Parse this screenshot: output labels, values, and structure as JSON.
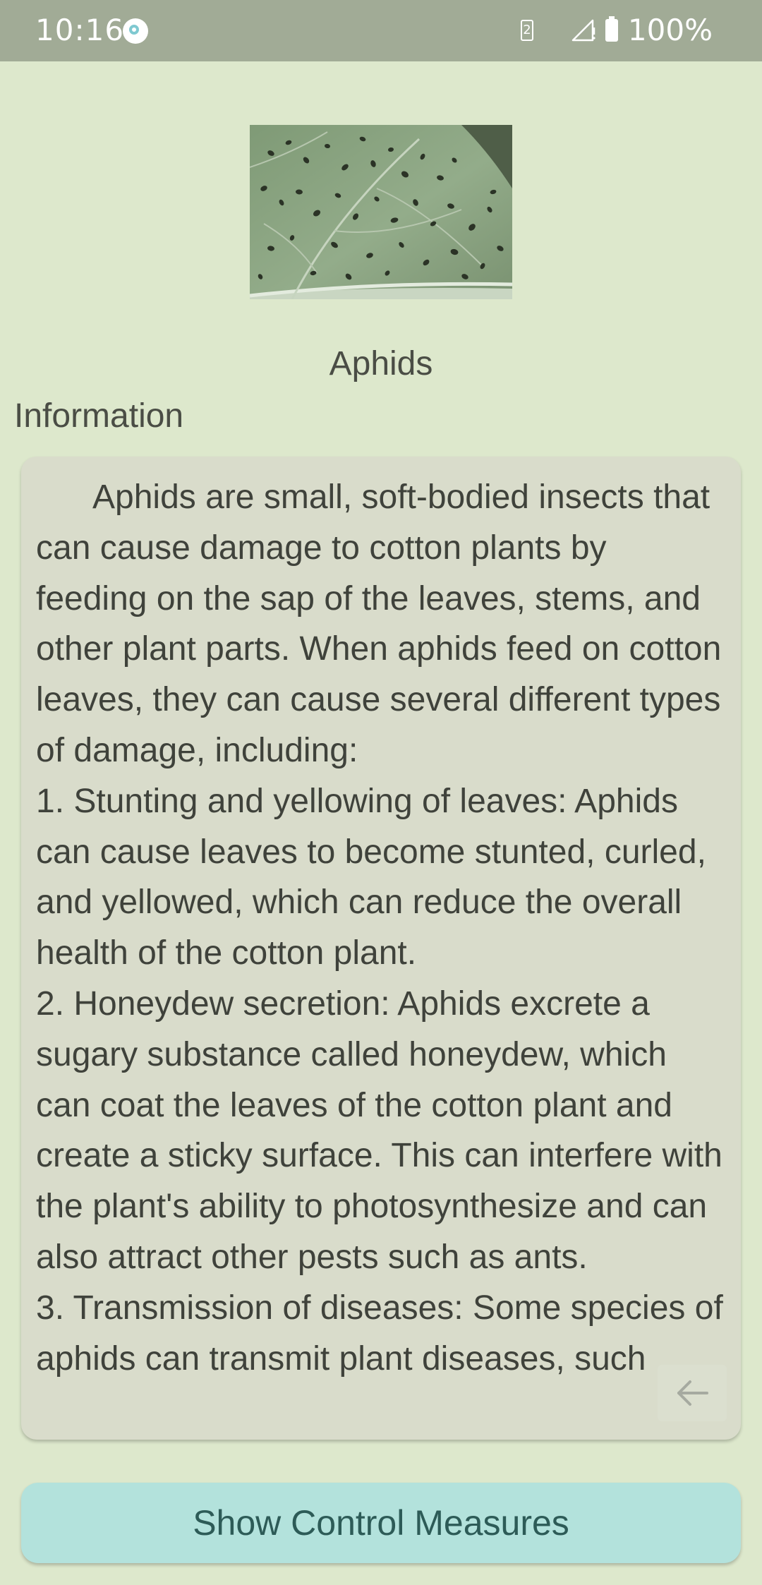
{
  "status_bar": {
    "time": "10:16",
    "sim_number": "2",
    "battery_percent": "100%"
  },
  "icons": {
    "app": "app-notification-icon",
    "sim": "sim-card-icon",
    "signal": "cell-signal-icon",
    "battery": "battery-charging-icon",
    "back": "back-arrow-icon"
  },
  "pest": {
    "name": "Aphids",
    "image": "aphids-on-leaf-photo"
  },
  "info_section": {
    "label": "Information",
    "text": "      Aphids are small, soft-bodied insects that can cause damage to cotton plants by feeding on the sap of the leaves, stems, and other plant parts. When aphids feed on cotton leaves, they can cause several different types of damage, including:\n1. Stunting and yellowing of leaves: Aphids can cause leaves to become stunted, curled, and yellowed, which can reduce the overall health of the cotton plant.\n2. Honeydew secretion: Aphids excrete a sugary substance called honeydew, which can coat the leaves of the cotton plant and create a sticky surface. This can interfere with the plant's ability to photosynthesize and can also attract other pests such as ants.\n3. Transmission of diseases: Some species of aphids can transmit plant diseases, such"
  },
  "actions": {
    "show_control_label": "Show Control Measures"
  },
  "colors": {
    "background": "#dde8cc",
    "status_bar": "#a1ab96",
    "card": "#d9dccb",
    "button": "#b3e2dc",
    "button_text": "#2d5b57"
  }
}
